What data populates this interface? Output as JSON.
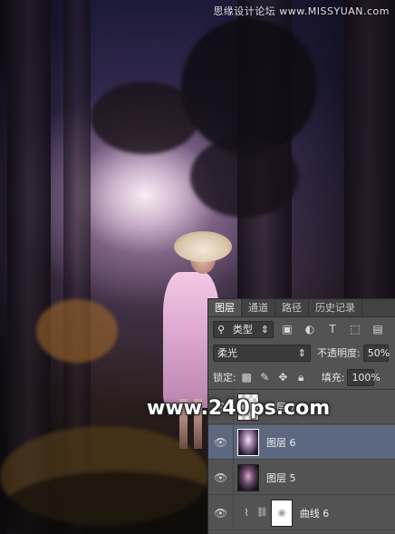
{
  "watermark_top": "思缘设计论坛 www.MISSYUAN.com",
  "watermark_big": "www.240ps.com",
  "panel": {
    "tabs": [
      {
        "label": "图层",
        "active": true
      },
      {
        "label": "通道",
        "active": false
      },
      {
        "label": "路径",
        "active": false
      },
      {
        "label": "历史记录",
        "active": false
      }
    ],
    "filter_kind": "类型",
    "filter_kind_icon": "search-icon",
    "blend_mode": "柔光",
    "opacity_label": "不透明度:",
    "opacity_value": "50%",
    "lock_label": "锁定:",
    "fill_label": "填充:",
    "fill_value": "100%",
    "layers": [
      {
        "name": "图层 7",
        "visible": true,
        "selected": false,
        "thumb": "transparent"
      },
      {
        "name": "图层 6",
        "visible": true,
        "selected": true,
        "thumb": "photo"
      },
      {
        "name": "图层 5",
        "visible": true,
        "selected": false,
        "thumb": "photo"
      },
      {
        "name": "曲线 6",
        "visible": true,
        "selected": false,
        "thumb": "curves-adjustment-with-mask"
      }
    ]
  },
  "colors": {
    "panel_bg": "#535353",
    "selected_layer": "#5b6880"
  }
}
